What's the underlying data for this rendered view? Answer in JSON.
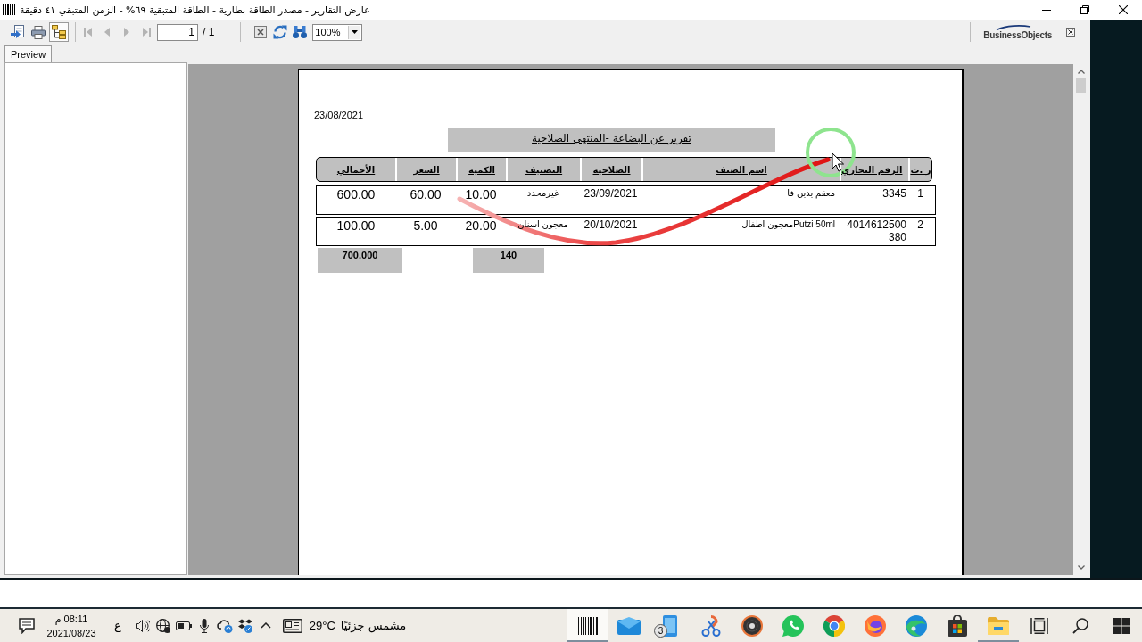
{
  "window": {
    "title": "عارض التقارير - مصدر الطاقة بطارية - الطاقة المتبقية ٦٩% - الزمن المتبقي ٤١ دقيقة"
  },
  "toolbar": {
    "actions": [
      {
        "kind": "export",
        "on": false
      },
      {
        "kind": "print",
        "on": false
      },
      {
        "kind": "group_tree",
        "on": true
      }
    ],
    "navigation": [
      {
        "kind": "first",
        "disabled": true
      },
      {
        "kind": "previous",
        "disabled": true
      },
      {
        "kind": "next",
        "disabled": true
      },
      {
        "kind": "last",
        "disabled": true
      }
    ],
    "page": {
      "value": "1",
      "total": "/ 1"
    },
    "tools": [
      {
        "kind": "stop"
      },
      {
        "kind": "refresh"
      },
      {
        "kind": "find"
      }
    ],
    "zoom": {
      "value": "100%"
    },
    "brand": "BusinessObjects"
  },
  "tabs": [
    {
      "label": "Preview",
      "selected": true
    }
  ],
  "report": {
    "date": "23/08/2021",
    "title": "تقرير عن البضاعة -المنتهى الصلاحية",
    "columns": [
      "ر .ت",
      "الرقم التجاري",
      "اسم الصنف",
      "الصلاحيه",
      "التصنيف",
      "الكمية",
      "السعر",
      "الأجمالي"
    ],
    "rows": [
      [
        "1",
        "3345",
        "معقم يدين فا",
        "23/09/2021",
        "غيرمحدد",
        "10.00",
        "60.00",
        "600.00"
      ],
      [
        "2",
        "4014612500380",
        "Putzi 50mlمعجون اطفال",
        "20/10/2021",
        "معجون اسنان",
        "20.00",
        "5.00",
        "100.00"
      ]
    ],
    "totals": {
      "amount": "700.000",
      "quantity": "140"
    }
  },
  "taskbar": {
    "clock": {
      "time": "08:11 م",
      "date": "2021/08/23"
    },
    "language": "ع",
    "weather": {
      "temperature": "29°C",
      "condition": "مشمس جزئيًا"
    },
    "apps": [
      {
        "kind": "barcode",
        "selected": true,
        "running": true
      },
      {
        "kind": "mail",
        "selected": false,
        "running": false
      },
      {
        "kind": "phone",
        "selected": false,
        "running": false,
        "badge": "3"
      },
      {
        "kind": "scissors",
        "selected": false,
        "running": false
      },
      {
        "kind": "disc",
        "selected": false,
        "running": false
      },
      {
        "kind": "chat",
        "selected": false,
        "running": false
      },
      {
        "kind": "tricolor",
        "selected": false,
        "running": false
      },
      {
        "kind": "flame",
        "selected": false,
        "running": false
      },
      {
        "kind": "wave",
        "selected": false,
        "running": false
      },
      {
        "kind": "store",
        "selected": false,
        "running": false
      },
      {
        "kind": "folder",
        "selected": false,
        "running": true
      }
    ]
  }
}
